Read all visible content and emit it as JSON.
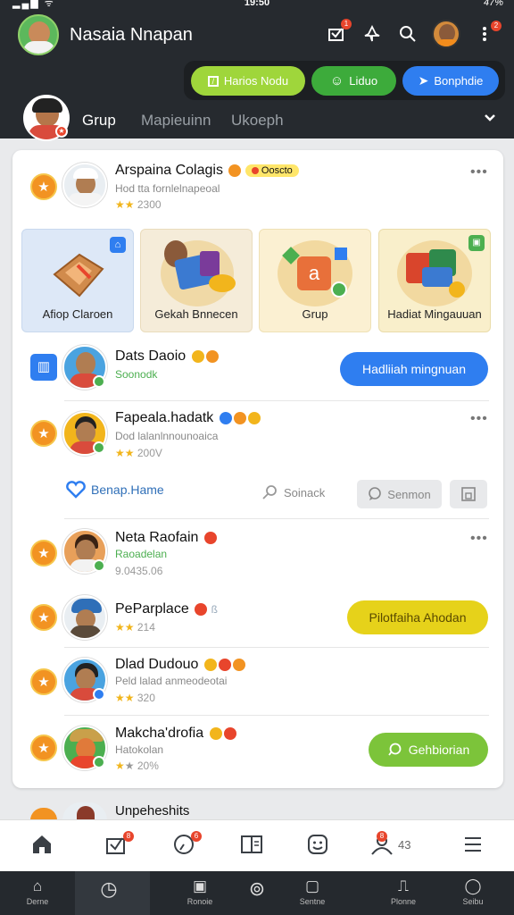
{
  "status": {
    "time": "19:50",
    "battery": "47%"
  },
  "header": {
    "title": "Nasaia Nnapan",
    "icons": [
      "inbox-icon",
      "bell-icon",
      "search-icon",
      "profile-avatar",
      "more-icon"
    ]
  },
  "pills": [
    {
      "label": "Harios Nodu",
      "color": "#9fd63b",
      "icon": "edit-icon"
    },
    {
      "label": "Liduo",
      "color": "#3dab3b",
      "icon": "chat-icon"
    },
    {
      "label": "Bonphdie",
      "color": "#2f7ef0",
      "icon": "send-icon"
    }
  ],
  "tabs": [
    {
      "label": "Grup",
      "active": true
    },
    {
      "label": "Mapieuinn",
      "active": false
    },
    {
      "label": "Ukoeph",
      "active": false
    }
  ],
  "featured": {
    "name": "Arspaina Colagis",
    "tag": "Ooscto",
    "sub": "Hod tta fornlelnapeoal",
    "rating": "2300"
  },
  "tiles": [
    {
      "label": "Afiop Claroen",
      "bg": "#dde8f7"
    },
    {
      "label": "Gekah Bnnecen",
      "bg": "#f5ecd9"
    },
    {
      "label": "Grup",
      "bg": "#fbf0d2"
    },
    {
      "label": "Hadiat Mingauuan",
      "bg": "#f9efcb"
    }
  ],
  "rows": [
    {
      "name": "Dats Daoio",
      "sub": "Soonodk",
      "button": "Hadliiah mingnuan"
    },
    {
      "name": "Fapeala.hadatk",
      "sub": "Dod lalanlnnounoaica",
      "rating": "200V"
    },
    {
      "name": "Neta Raofain",
      "sub": "Raoadelan",
      "rating": "9.0435.06"
    },
    {
      "name": "PeParplace",
      "rating": "214",
      "button": "Pilotfaiha Ahodan"
    },
    {
      "name": "Dlad Dudouo",
      "sub": "Peld lalad anmeodeotai",
      "rating": "320"
    },
    {
      "name": "Makcha'drofia",
      "sub": "Hatokolan",
      "rating": "20%",
      "button": "Gehbiorian"
    },
    {
      "name": "Unpeheshits"
    }
  ],
  "actions": {
    "share": "Benap.Hame",
    "search": "Soinack",
    "comment": "Senmon"
  },
  "bottom_nav": [
    {
      "icon": "home-icon"
    },
    {
      "icon": "inbox-icon",
      "badge": "8"
    },
    {
      "icon": "clock-icon",
      "badge": "6"
    },
    {
      "icon": "book-icon"
    },
    {
      "icon": "smile-icon"
    },
    {
      "icon": "people-icon",
      "badge": "8",
      "count": "43"
    },
    {
      "icon": "menu-icon"
    }
  ],
  "sys_nav": [
    {
      "label": "Derne",
      "icon": "home-icon"
    },
    {
      "label": "",
      "icon": "clock-icon"
    },
    {
      "label": "Ronoie",
      "icon": "box-icon"
    },
    {
      "label": "",
      "icon": "alarm-icon"
    },
    {
      "label": "Sentne",
      "icon": "flag-icon"
    },
    {
      "label": "Plonne",
      "icon": "bell-icon"
    },
    {
      "label": "Seibu",
      "icon": "globe-icon"
    }
  ]
}
